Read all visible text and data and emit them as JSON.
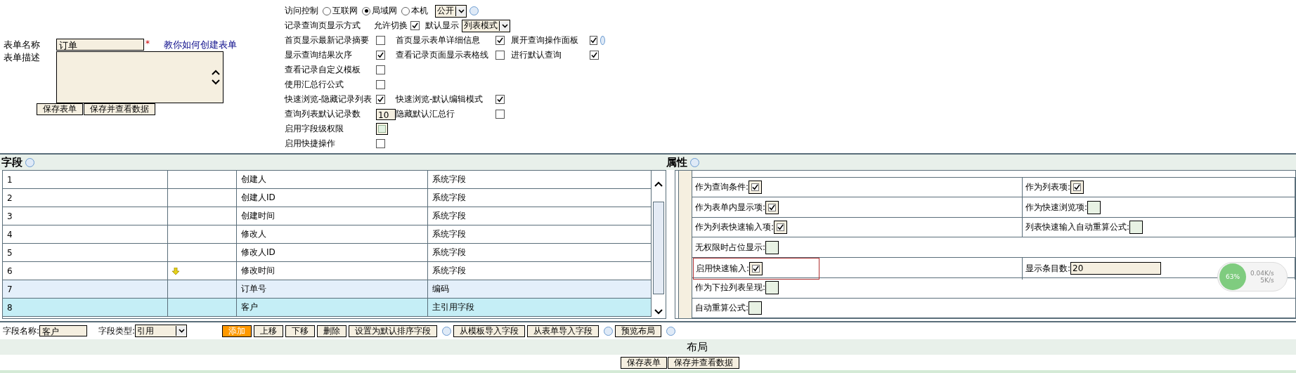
{
  "form": {
    "name_label": "表单名称",
    "name_value": "订单",
    "required_mark": "*",
    "help_link": "教你如何创建表单",
    "desc_label": "表单描述",
    "buttons": [
      "保存表单",
      "保存并查看数据"
    ]
  },
  "access": {
    "label": "访问控制",
    "options": [
      {
        "label": "互联网",
        "selected": false
      },
      {
        "label": "局域网",
        "selected": true
      },
      {
        "label": "本机",
        "selected": false
      }
    ],
    "select": "公开"
  },
  "display_mode": {
    "label": "记录查询页显示方式",
    "switch_label": "允许切换",
    "switch_checked": true,
    "default_label": "默认显示",
    "default_select": "列表模式"
  },
  "options": [
    {
      "cells": [
        {
          "label": "首页显示最新记录摘要",
          "kind": "checkbox",
          "checked": false
        },
        {
          "label": "首页显示表单详细信息",
          "kind": "checkbox",
          "checked": true
        },
        {
          "label": "展开查询操作面板",
          "kind": "checkbox",
          "checked": true,
          "help": true
        }
      ]
    },
    {
      "cells": [
        {
          "label": "显示查询结果次序",
          "kind": "checkbox",
          "checked": true
        },
        {
          "label": "查看记录页面显示表格线",
          "kind": "checkbox",
          "checked": false
        },
        {
          "label": "进行默认查询",
          "kind": "checkbox",
          "checked": true
        }
      ]
    },
    {
      "cells": [
        {
          "label": "查看记录自定义模板",
          "kind": "checkbox",
          "checked": false
        }
      ]
    },
    {
      "cells": [
        {
          "label": "使用汇总行公式",
          "kind": "checkbox",
          "checked": false
        }
      ]
    },
    {
      "cells": [
        {
          "label": "快速浏览-隐藏记录列表",
          "kind": "checkbox",
          "checked": true
        },
        {
          "label": "快速浏览-默认编辑模式",
          "kind": "checkbox",
          "checked": true
        }
      ]
    },
    {
      "cells": [
        {
          "label": "查询列表默认记录数",
          "kind": "input",
          "value": "10"
        },
        {
          "label": "隐藏默认汇总行",
          "kind": "checkbox",
          "checked": false
        }
      ]
    },
    {
      "cells": [
        {
          "label": "启用字段级权限",
          "kind": "toggle",
          "checked": false
        }
      ]
    },
    {
      "cells": [
        {
          "label": "启用快捷操作",
          "kind": "checkbox",
          "checked": false
        }
      ]
    }
  ],
  "fields_panel": {
    "title": "字段",
    "rows": [
      {
        "num": "1",
        "arrow": false,
        "name": "创建人",
        "type": "系统字段",
        "custom": false,
        "selected": false
      },
      {
        "num": "2",
        "arrow": false,
        "name": "创建人ID",
        "type": "系统字段",
        "custom": false,
        "selected": false
      },
      {
        "num": "3",
        "arrow": false,
        "name": "创建时间",
        "type": "系统字段",
        "custom": false,
        "selected": false
      },
      {
        "num": "4",
        "arrow": false,
        "name": "修改人",
        "type": "系统字段",
        "custom": false,
        "selected": false
      },
      {
        "num": "5",
        "arrow": false,
        "name": "修改人ID",
        "type": "系统字段",
        "custom": false,
        "selected": false
      },
      {
        "num": "6",
        "arrow": true,
        "name": "修改时间",
        "type": "系统字段",
        "custom": false,
        "selected": false
      },
      {
        "num": "7",
        "arrow": false,
        "name": "订单号",
        "type": "编码",
        "custom": true,
        "selected": false
      },
      {
        "num": "8",
        "arrow": false,
        "name": "客户",
        "type": "主引用字段",
        "custom": true,
        "selected": true
      }
    ]
  },
  "properties_panel": {
    "title": "属性",
    "rows": [
      [
        {
          "label": "作为查询条件:",
          "kind": "checkbox",
          "checked": true
        },
        {
          "label": "作为列表项:",
          "kind": "checkbox",
          "checked": true
        }
      ],
      [
        {
          "label": "作为表单内显示项:",
          "kind": "checkbox",
          "checked": true
        },
        {
          "label": "作为快速浏览项:",
          "kind": "checkbox",
          "checked": false
        }
      ],
      [
        {
          "label": "作为列表快速输入项:",
          "kind": "checkbox",
          "checked": true
        },
        {
          "label": "列表快速输入自动重算公式:",
          "kind": "checkbox",
          "checked": false
        }
      ],
      [
        {
          "label": "无权限时占位显示:",
          "kind": "checkbox",
          "checked": false
        }
      ],
      [
        {
          "label": "启用快速输入:",
          "kind": "checkbox",
          "checked": true,
          "focused": true
        },
        {
          "label": "显示条目数:",
          "kind": "input",
          "value": "20"
        }
      ],
      [
        {
          "label": "作为下拉列表呈现:",
          "kind": "checkbox",
          "checked": false
        }
      ],
      [
        {
          "label": "自动重算公式:",
          "kind": "checkbox",
          "checked": false
        }
      ]
    ]
  },
  "field_toolbar": {
    "name_label": "字段名称:",
    "name_value": "客户",
    "type_label": "字段类型:",
    "type_value": "引用",
    "buttons": [
      {
        "label": "添加",
        "primary": true,
        "help": false
      },
      {
        "label": "上移",
        "primary": false,
        "help": false
      },
      {
        "label": "下移",
        "primary": false,
        "help": false
      },
      {
        "label": "删除",
        "primary": false,
        "help": false
      },
      {
        "label": "设置为默认排序字段",
        "primary": false,
        "help": true
      },
      {
        "label": "从模板导入字段",
        "primary": false,
        "help": false
      },
      {
        "label": "从表单导入字段",
        "primary": false,
        "help": true
      },
      {
        "label": "预览布局",
        "primary": false,
        "help": true
      }
    ]
  },
  "layout": {
    "title": "布局",
    "buttons": [
      "保存表单",
      "保存并查看数据"
    ]
  },
  "speed_widget": {
    "percent": "63%",
    "upload": "0.04K/s",
    "download": "5K/s"
  }
}
